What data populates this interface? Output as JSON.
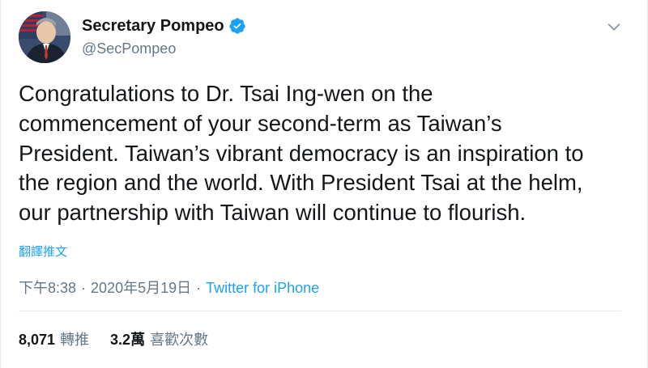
{
  "account": {
    "display_name": "Secretary Pompeo",
    "handle": "@SecPompeo",
    "verified": true
  },
  "tweet": {
    "text": "Congratulations to Dr. Tsai Ing-wen on the\ncommencement of your second-term as Taiwan’s\nPresident. Taiwan’s vibrant democracy is an inspiration to\nthe region and the world. With President Tsai at the helm,\nour partnership with Taiwan will continue to flourish.",
    "translate_label": "翻譯推文",
    "time": "下午8:38",
    "date": "2020年5月19日",
    "separator": "·",
    "source": "Twitter for iPhone"
  },
  "stats": {
    "retweets_count": "8,071",
    "retweets_label": "轉推",
    "likes_count": "3.2萬",
    "likes_label": "喜歡次數"
  },
  "icons": {
    "verified": "verified-badge-icon",
    "caret": "chevron-down-icon"
  },
  "colors": {
    "accent": "#1da1f2",
    "text": "#14171a",
    "muted": "#657786",
    "divider": "#e6ecf0"
  }
}
